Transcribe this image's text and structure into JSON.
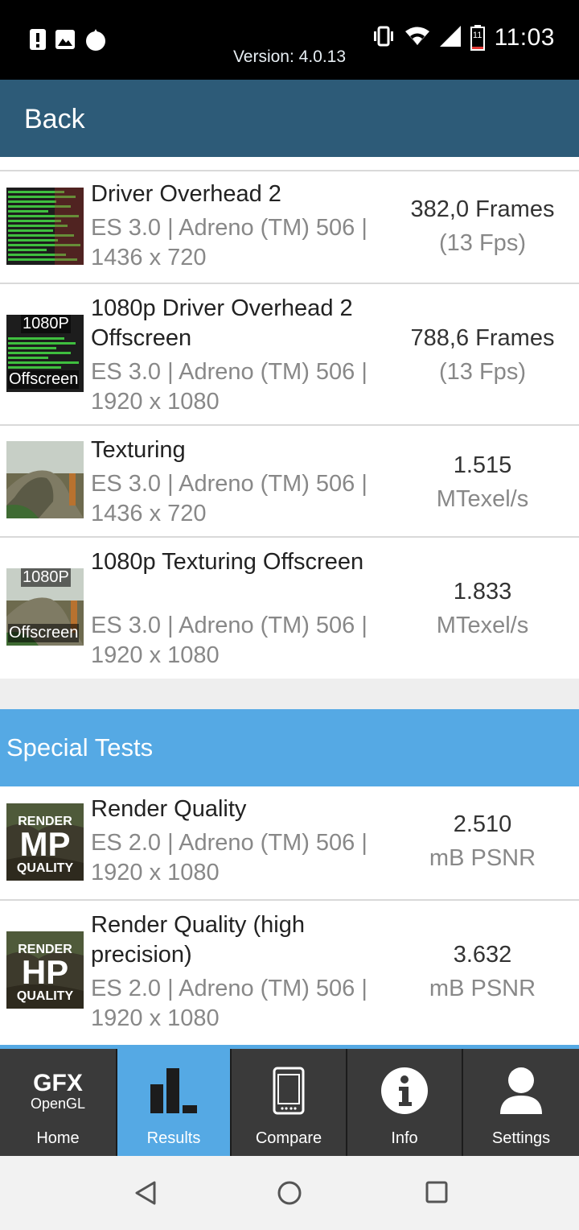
{
  "status_bar": {
    "time": "11:03",
    "battery_level": "11",
    "left_icons": [
      "alert-icon",
      "image-icon",
      "fire-icon"
    ],
    "right_icons": [
      "vibrate-icon",
      "wifi-icon",
      "signal-icon",
      "battery-icon"
    ]
  },
  "header": {
    "back_label": "Back",
    "version": "Version: 4.0.13"
  },
  "results": [
    {
      "title": "Driver Overhead 2",
      "subtitle": "ES 3.0 | Adreno (TM) 506 | 1436 x 720",
      "score": "382,0 Frames",
      "unit": "(13 Fps)",
      "thumb_badge_top": "",
      "thumb_badge_bottom": ""
    },
    {
      "title": "1080p Driver Overhead 2 Offscreen",
      "subtitle": "ES 3.0 | Adreno (TM) 506 | 1920 x 1080",
      "score": "788,6 Frames",
      "unit": "(13 Fps)",
      "thumb_badge_top": "1080P",
      "thumb_badge_bottom": "Offscreen"
    },
    {
      "title": "Texturing",
      "subtitle": "ES 3.0 | Adreno (TM) 506 | 1436 x 720",
      "score": "1.515",
      "unit": "MTexel/s",
      "thumb_badge_top": "",
      "thumb_badge_bottom": ""
    },
    {
      "title": "1080p Texturing Offscreen",
      "subtitle": "ES 3.0 | Adreno (TM) 506 | 1920 x 1080",
      "score": "1.833",
      "unit": "MTexel/s",
      "thumb_badge_top": "1080P",
      "thumb_badge_bottom": "Offscreen"
    }
  ],
  "special_section": {
    "title": "Special Tests",
    "items": [
      {
        "title": "Render Quality",
        "subtitle": "ES 2.0 | Adreno (TM) 506 | 1920 x 1080",
        "score": "2.510",
        "unit": "mB PSNR",
        "badge_top": "RENDER",
        "badge_main": "MP",
        "badge_bottom": "QUALITY"
      },
      {
        "title": "Render Quality (high precision)",
        "subtitle": "ES 2.0 | Adreno (TM) 506 | 1920 x 1080",
        "score": "3.632",
        "unit": "mB PSNR",
        "badge_top": "RENDER",
        "badge_main": "HP",
        "badge_bottom": "QUALITY"
      }
    ]
  },
  "bottom_nav": {
    "items": [
      {
        "label": "Home",
        "logo_main": "GFX",
        "logo_sub": "OpenGL",
        "active": false
      },
      {
        "label": "Results",
        "icon": "bar-chart-icon",
        "active": true
      },
      {
        "label": "Compare",
        "icon": "phone-icon",
        "active": false
      },
      {
        "label": "Info",
        "icon": "info-icon",
        "active": false
      },
      {
        "label": "Settings",
        "icon": "user-icon",
        "active": false
      }
    ]
  },
  "system_nav": [
    "back-triangle-icon",
    "home-circle-icon",
    "recents-square-icon"
  ],
  "colors": {
    "header_bg": "#2d5b78",
    "section_bg": "#55a9e4",
    "nav_bg": "#3a3a3a",
    "nav_active": "#55a9e4"
  }
}
